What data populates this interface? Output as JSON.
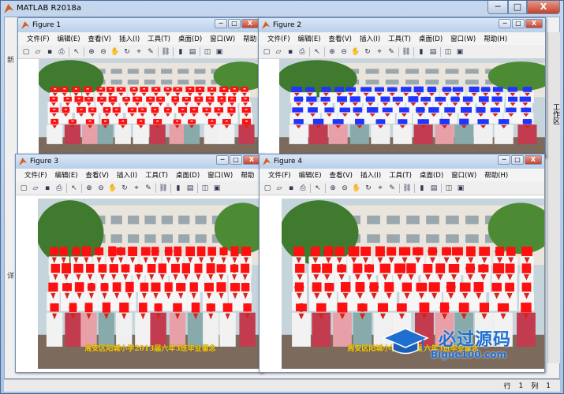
{
  "app": {
    "title": "MATLAB R2018a",
    "minimize": "─",
    "maximize": "□",
    "close": "X"
  },
  "side": {
    "left_labels": [
      "新",
      "详"
    ],
    "right_label": "工作区"
  },
  "status": {
    "row_label": "行",
    "row_value": "1",
    "col_label": "列",
    "col_value": "1"
  },
  "figure_menu": [
    "文件(F)",
    "编辑(E)",
    "查看(V)",
    "插入(I)",
    "工具(T)",
    "桌面(D)",
    "窗口(W)",
    "帮助(H)"
  ],
  "figure_menu_short": [
    "文件(F)",
    "编辑(E)",
    "查看(V)",
    "插入(I)",
    "工具(T)",
    "桌面(D)",
    "窗口(W)",
    "帮助"
  ],
  "figures": [
    {
      "title": "Figure 1",
      "marker_color": "#ff1010",
      "marker_style": "square-with-dot"
    },
    {
      "title": "Figure 2",
      "marker_color": "#1f35ff",
      "marker_style": "solid"
    },
    {
      "title": "Figure 3",
      "marker_color": "#ff1010",
      "marker_style": "solid"
    },
    {
      "title": "Figure 4",
      "marker_color": "#ff1010",
      "marker_style": "solid"
    }
  ],
  "caption": "周安区阳城小学2013届六年3班毕业留念",
  "watermark": {
    "name": "必过源码",
    "url": "Bigue100.com"
  },
  "icons": [
    "new-file-icon",
    "open-folder-icon",
    "save-icon",
    "print-icon",
    "pointer-icon",
    "zoom-in-icon",
    "zoom-out-icon",
    "pan-icon",
    "rotate-icon",
    "data-cursor-icon",
    "brush-icon",
    "link-icon",
    "colorbar-icon",
    "legend-icon",
    "hide-tools-icon",
    "dock-icon"
  ]
}
